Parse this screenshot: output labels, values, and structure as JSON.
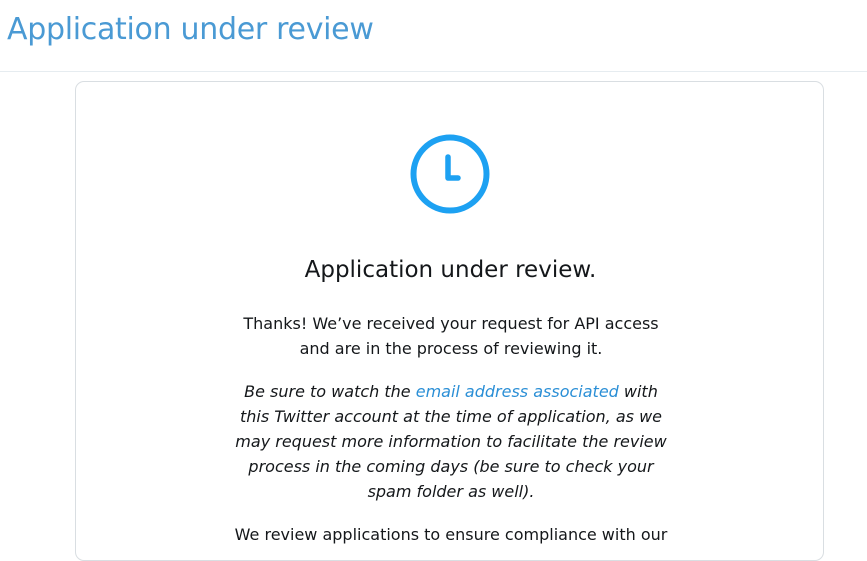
{
  "header": {
    "title": "Application under review"
  },
  "card": {
    "icon": "clock-icon",
    "title": "Application under review.",
    "paragraph1": "Thanks! We’ve received your request for API access and are in the process of reviewing it.",
    "paragraph2": {
      "before_link": "Be sure to watch the ",
      "link_text": "email address associated",
      "after_link": " with this Twitter account at the time of application, as we may request more information to facilitate the review process in the coming days (be sure to check your spam folder as well)."
    },
    "paragraph3": "We review applications to ensure compliance with our"
  },
  "colors": {
    "accent": "#1da1f2",
    "header_title": "#4a9ad4",
    "link": "#2b8fd6",
    "text": "#14171a"
  }
}
